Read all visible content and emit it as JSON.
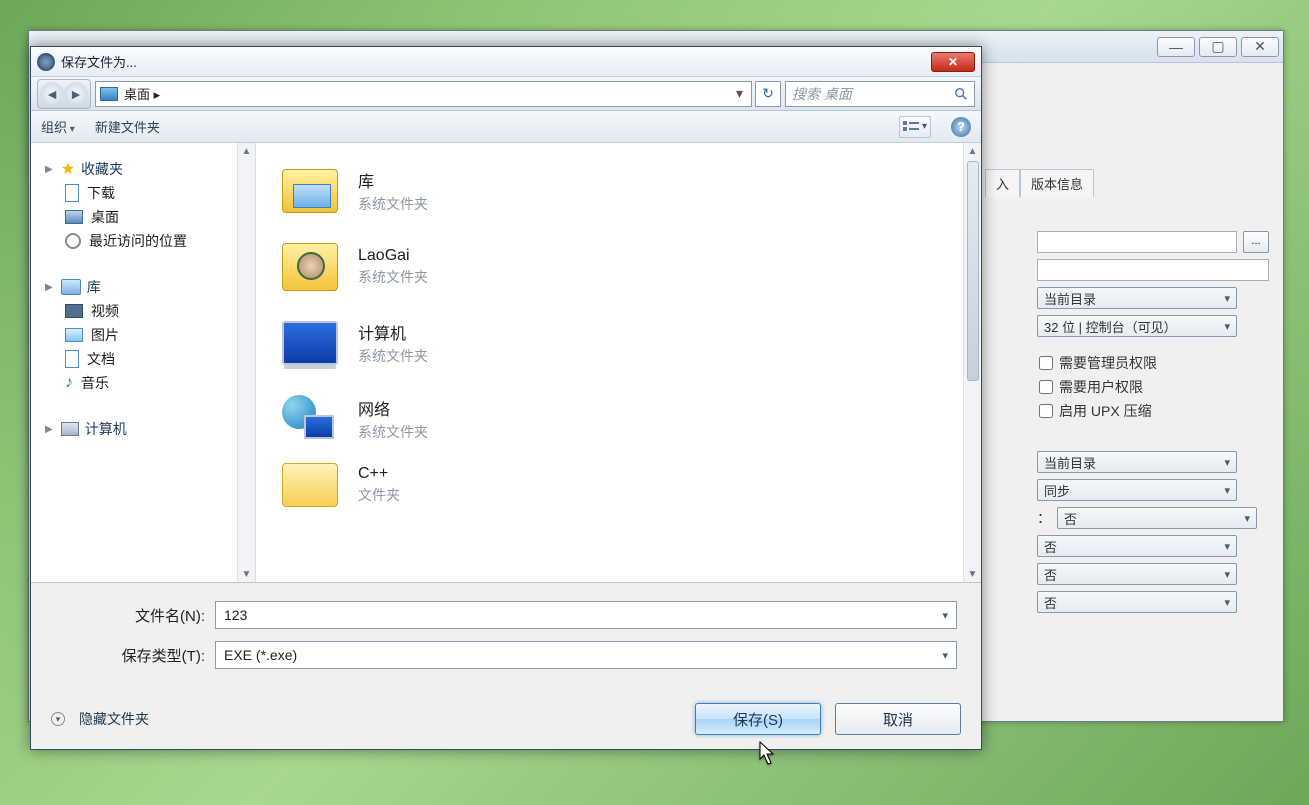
{
  "dialog": {
    "title": "保存文件为...",
    "breadcrumb": "桌面  ▸",
    "search_placeholder": "搜索 桌面",
    "cmdbar": {
      "organize": "组织",
      "new_folder": "新建文件夹"
    },
    "nav": {
      "favorites": "收藏夹",
      "downloads": "下载",
      "desktop": "桌面",
      "recent": "最近访问的位置",
      "libraries": "库",
      "videos": "视频",
      "pictures": "图片",
      "documents": "文档",
      "music": "音乐",
      "computer": "计算机"
    },
    "items": [
      {
        "name": "库",
        "sub": "系统文件夹"
      },
      {
        "name": "LaoGai",
        "sub": "系统文件夹"
      },
      {
        "name": "计算机",
        "sub": "系统文件夹"
      },
      {
        "name": "网络",
        "sub": "系统文件夹"
      },
      {
        "name": "C++",
        "sub": "文件夹"
      }
    ],
    "filename_label": "文件名(N):",
    "filename_value": "123",
    "filetype_label": "保存类型(T):",
    "filetype_value": "EXE (*.exe)",
    "hide_folders": "隐藏文件夹",
    "save_btn": "保存(S)",
    "cancel_btn": "取消"
  },
  "background": {
    "tabs": {
      "input": "入",
      "version": "版本信息"
    },
    "browse": "...",
    "combo1": "当前目录",
    "combo2": "32 位 | 控制台（可见）",
    "check_admin": "需要管理员权限",
    "check_user": "需要用户权限",
    "check_upx": "启用 UPX 压缩",
    "combo3": "当前目录",
    "combo4": "同步",
    "sep_label": "：",
    "combo5": "否",
    "combo6": "否",
    "combo7": "否",
    "combo8": "否"
  }
}
